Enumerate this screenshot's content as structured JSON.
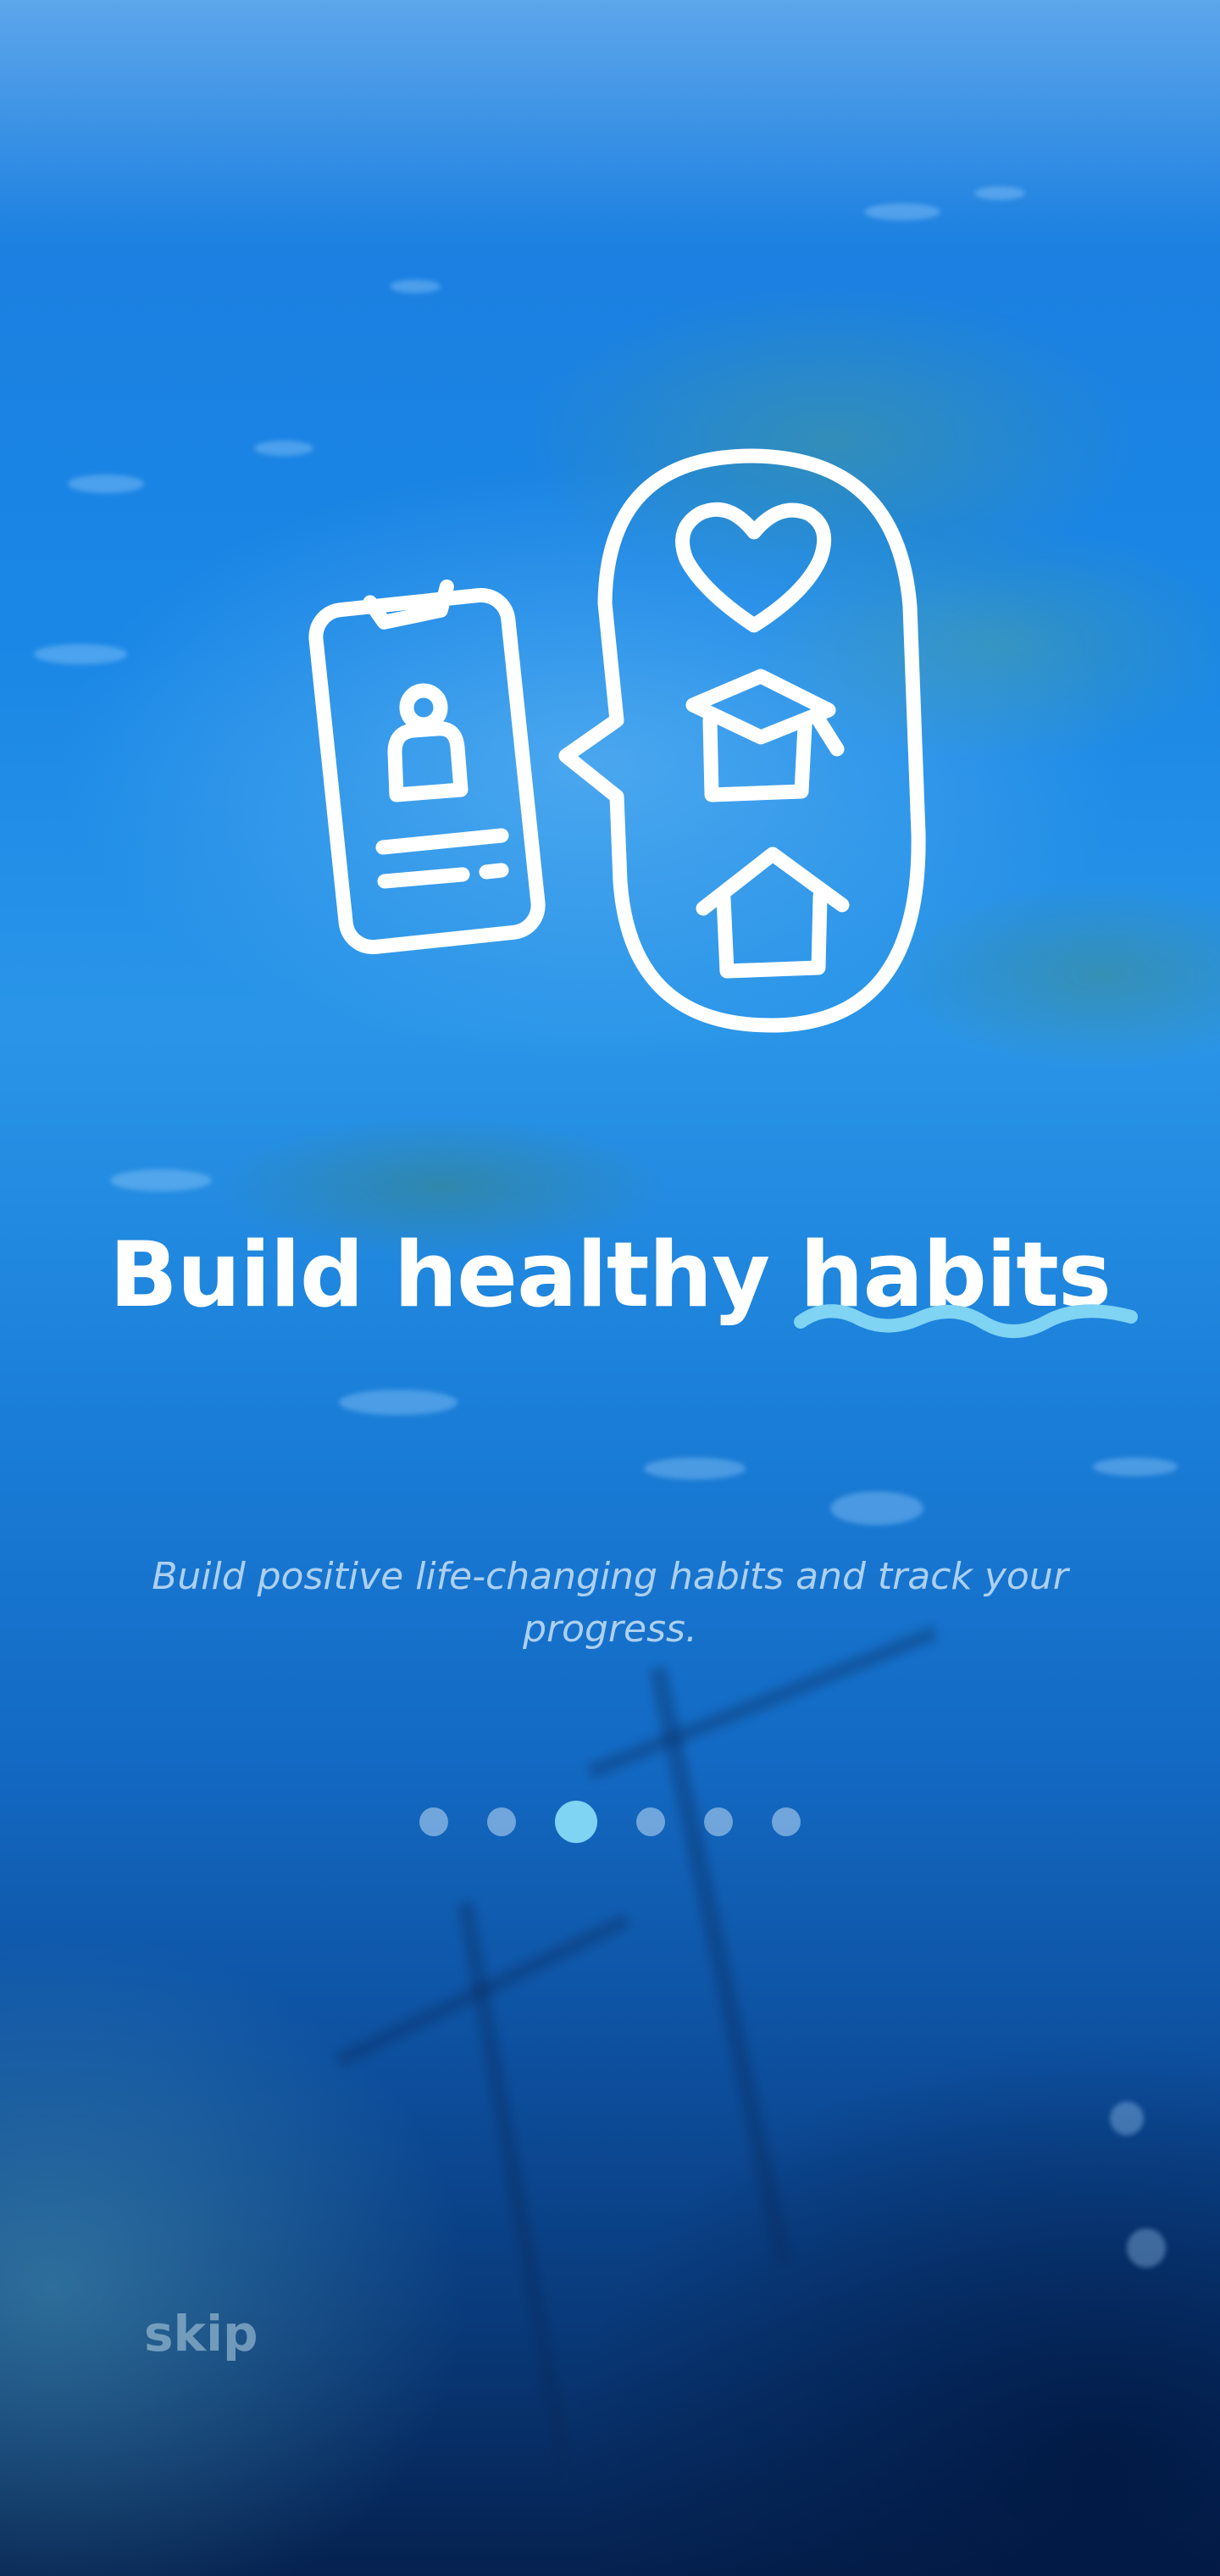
{
  "onboarding": {
    "title": "Build healthy habits",
    "subtitle": "Build positive life-changing habits and track your progress.",
    "skip_label": "skip",
    "page_count": 6,
    "active_page": 3,
    "illustration_icons": [
      "phone-profile-icon",
      "speech-bubble-icon",
      "heart-icon",
      "graduation-cap-icon",
      "house-icon"
    ]
  },
  "colors": {
    "accent": "#7fd3f3",
    "text_primary": "#ffffff",
    "background_top": "#2d86e0",
    "background_bottom": "#05214f"
  }
}
